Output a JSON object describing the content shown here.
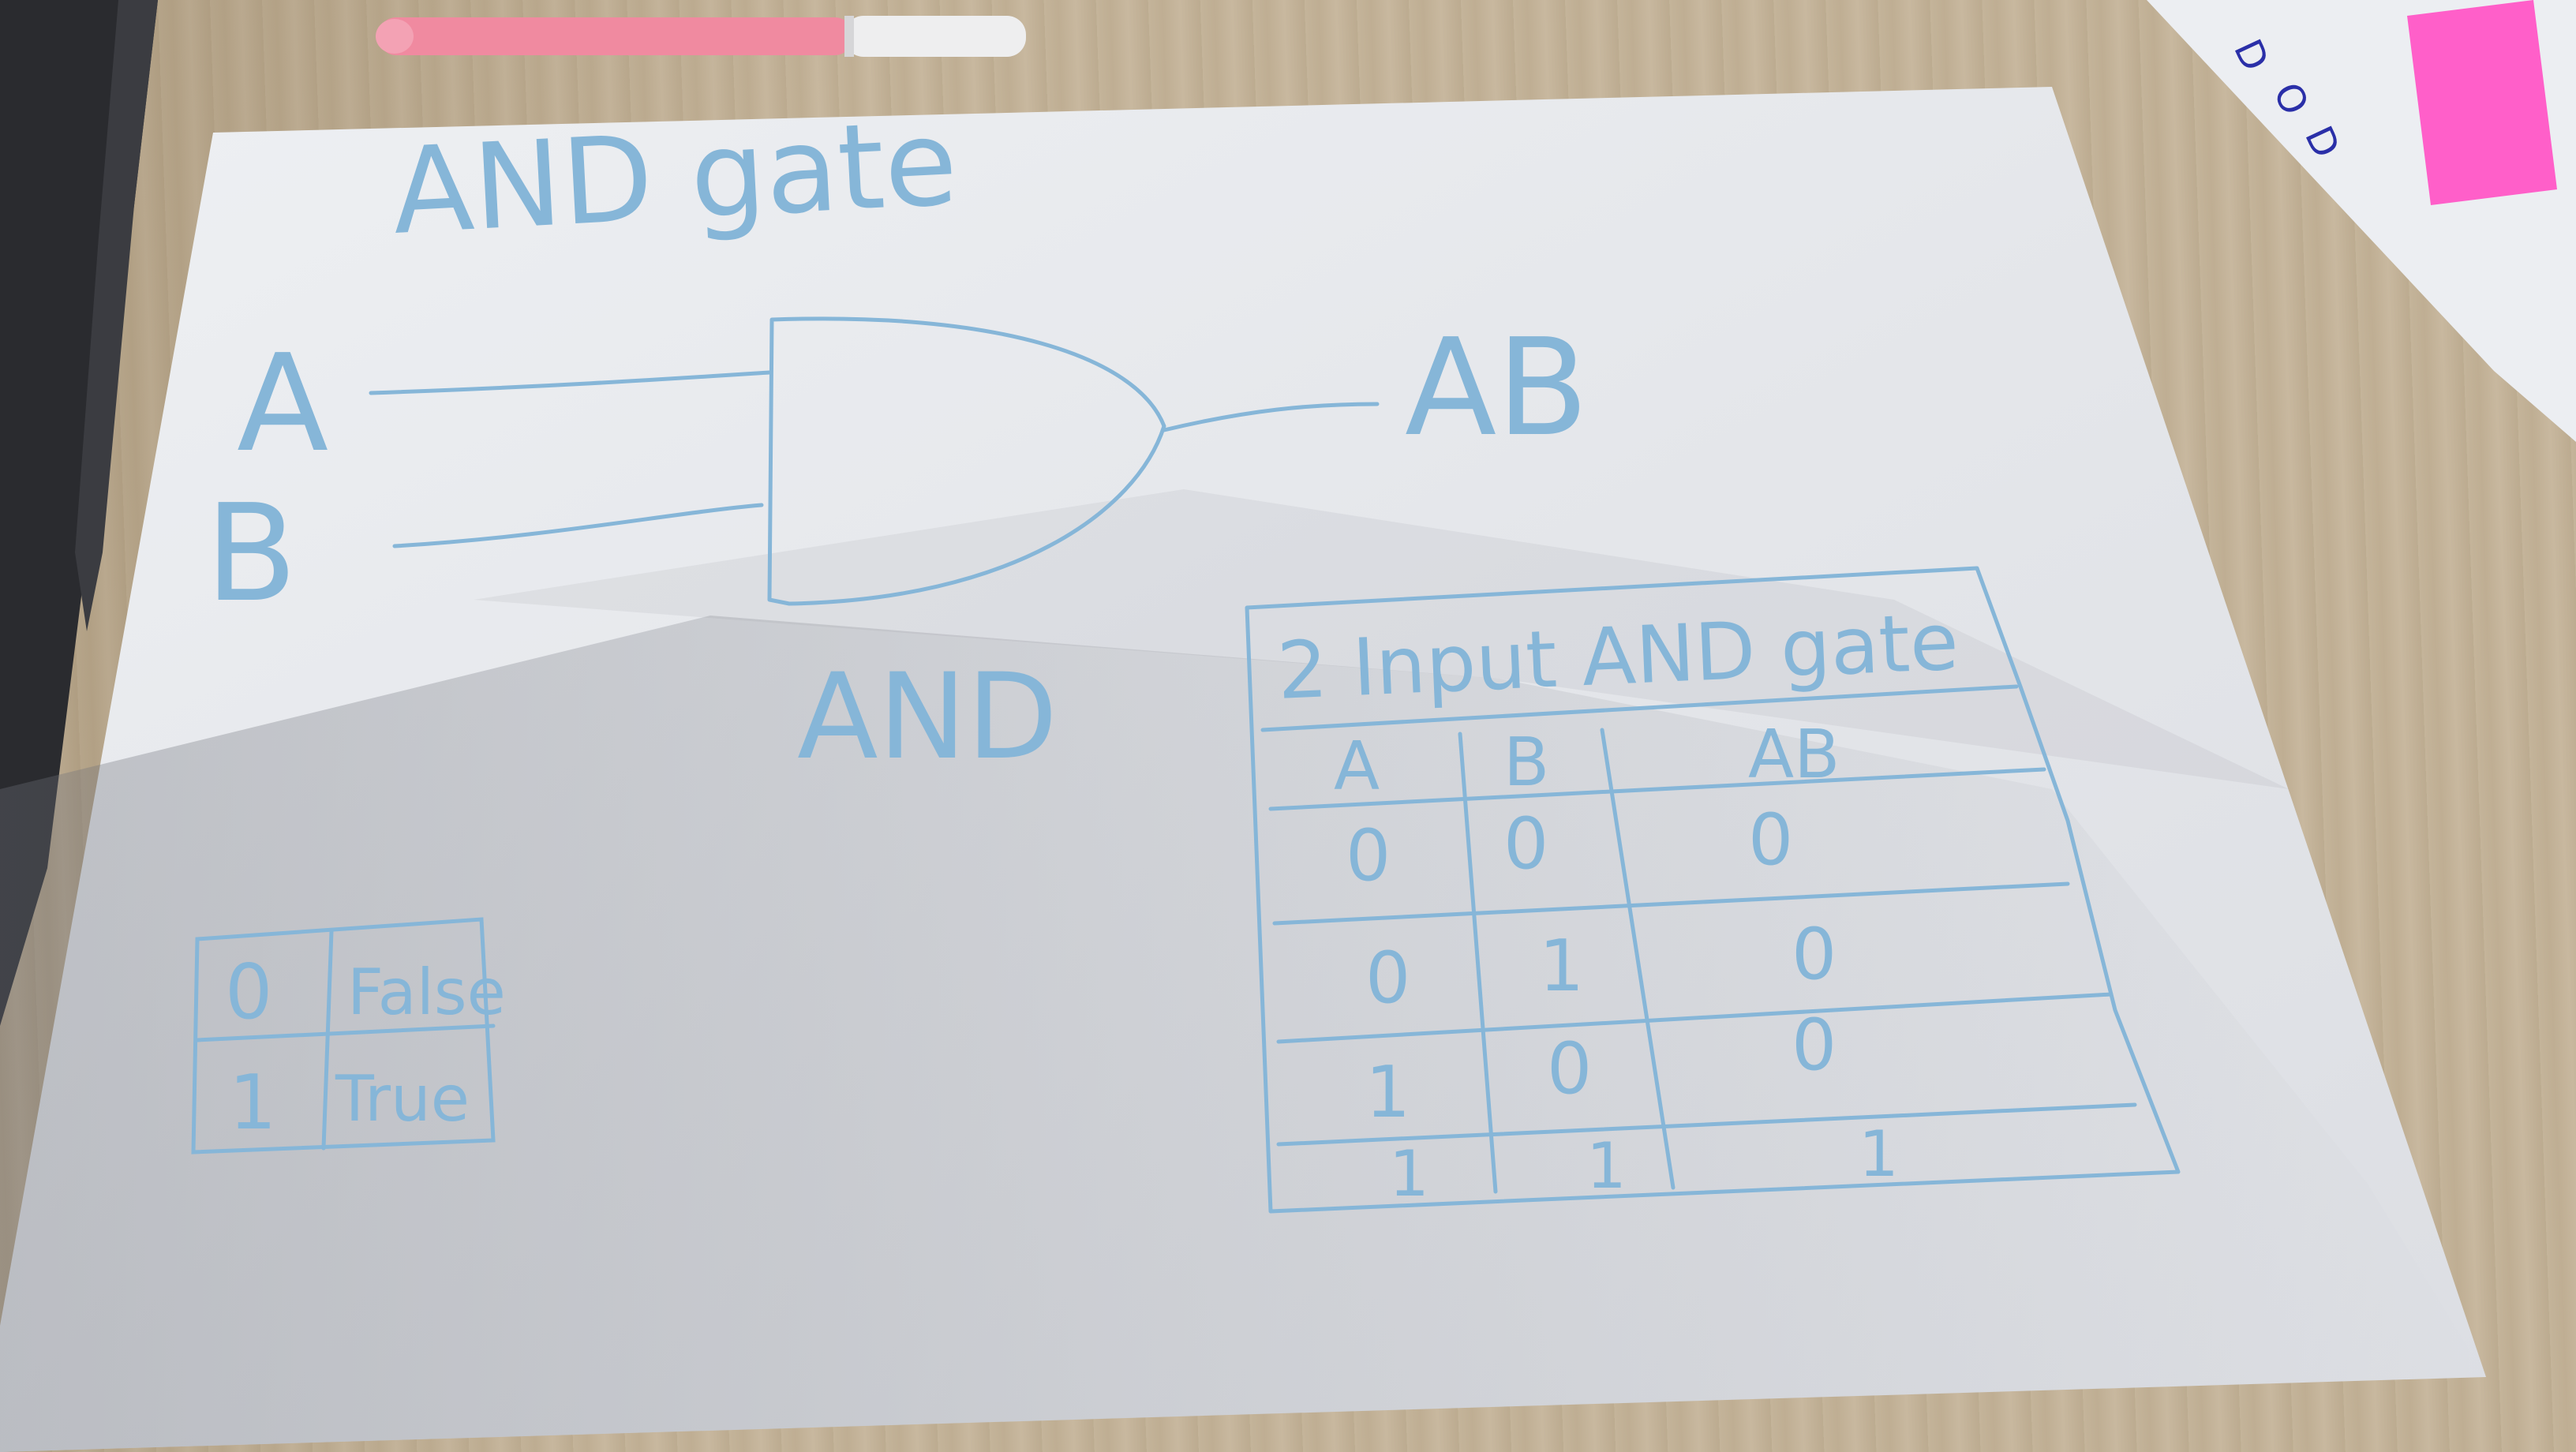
{
  "drawing": {
    "title": "AND gate",
    "input_a": "A",
    "input_b": "B",
    "output": "AB",
    "gate_label": "AND"
  },
  "truth_table": {
    "title": "2 Input AND gate",
    "headers": [
      "A",
      "B",
      "AB"
    ],
    "rows": [
      [
        "0",
        "0",
        "0"
      ],
      [
        "0",
        "1",
        "0"
      ],
      [
        "1",
        "0",
        "0"
      ],
      [
        "1",
        "1",
        "1"
      ]
    ]
  },
  "legend_table": {
    "rows": [
      [
        "0",
        "False"
      ],
      [
        "1",
        "True"
      ]
    ]
  },
  "colors": {
    "paper": "#e6e8ec",
    "ink": "#86b6d8",
    "desk": "#c4b49a",
    "pen_body": "#f08aa0",
    "sticky_note": "#ff5fc9"
  }
}
